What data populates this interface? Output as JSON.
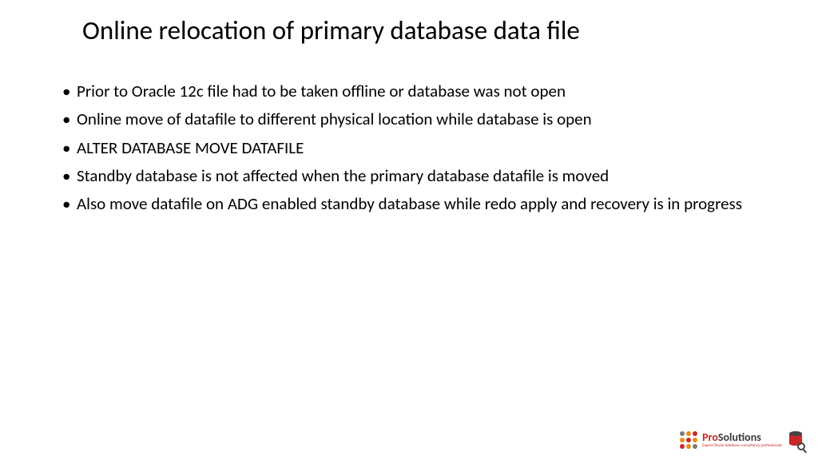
{
  "slide": {
    "title": "Online relocation of primary database data file",
    "bullets": [
      "Prior to Oracle 12c file had to be taken offline or database was not open",
      "Online move of datafile to different physical location while database is open",
      "ALTER DATABASE MOVE DATAFILE",
      "Standby database is not affected when the primary database datafile is moved",
      "Also move datafile on ADG enabled standby database while redo apply and recovery is in progress"
    ]
  },
  "logo": {
    "brand_pro": "Pro",
    "brand_sol": "Solutions",
    "tagline": "Expert Oracle database consultancy professionals"
  }
}
